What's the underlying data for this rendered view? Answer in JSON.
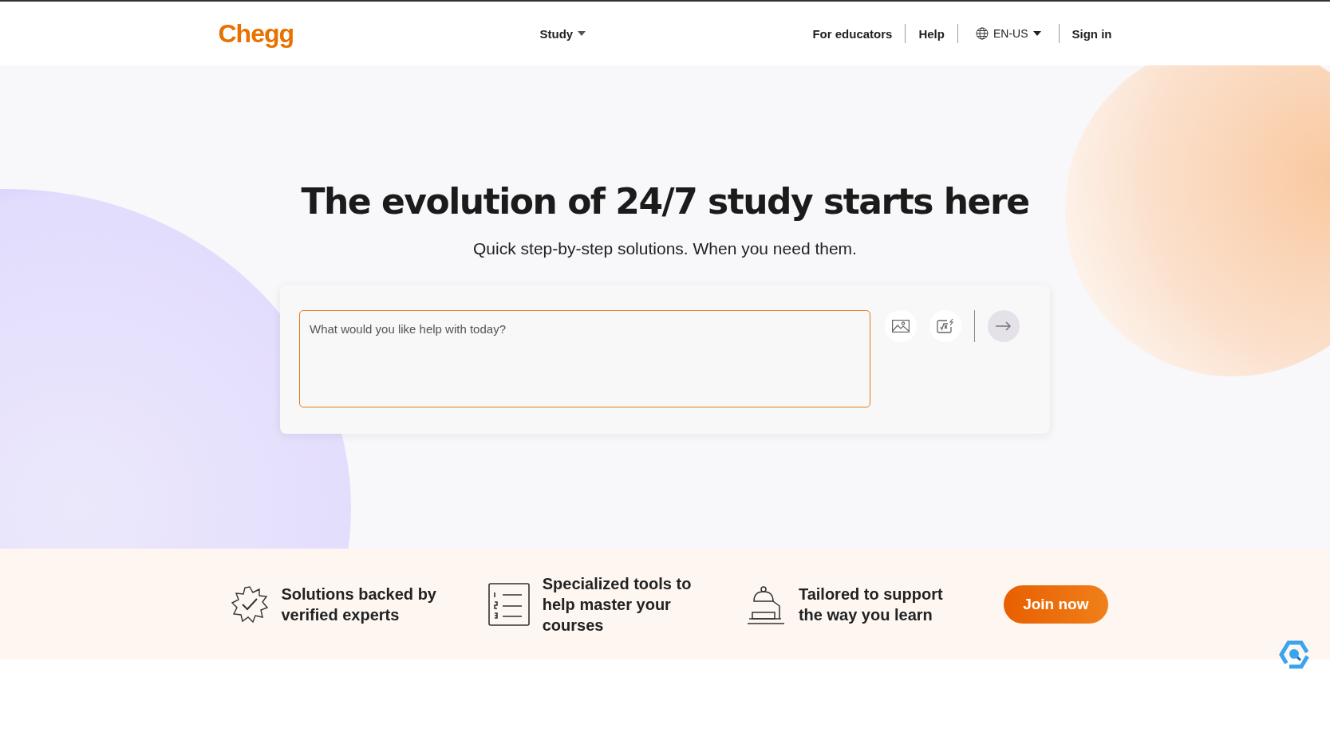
{
  "header": {
    "logo": "Chegg",
    "study_menu": "Study",
    "links": [
      "For educators",
      "Help"
    ],
    "language": "EN-US",
    "sign_in": "Sign in"
  },
  "hero": {
    "title": "The evolution of 24/7 study starts here",
    "subtitle": "Quick step-by-step solutions. When you need them.",
    "search": {
      "placeholder": "What would you like help with today?"
    }
  },
  "features": [
    {
      "kind": "badge",
      "text": "Solutions backed by verified experts"
    },
    {
      "kind": "list",
      "text": "Specialized tools to help master your courses"
    },
    {
      "kind": "lamp",
      "text": "Tailored to support the way you learn"
    }
  ],
  "join_button": "Join now"
}
